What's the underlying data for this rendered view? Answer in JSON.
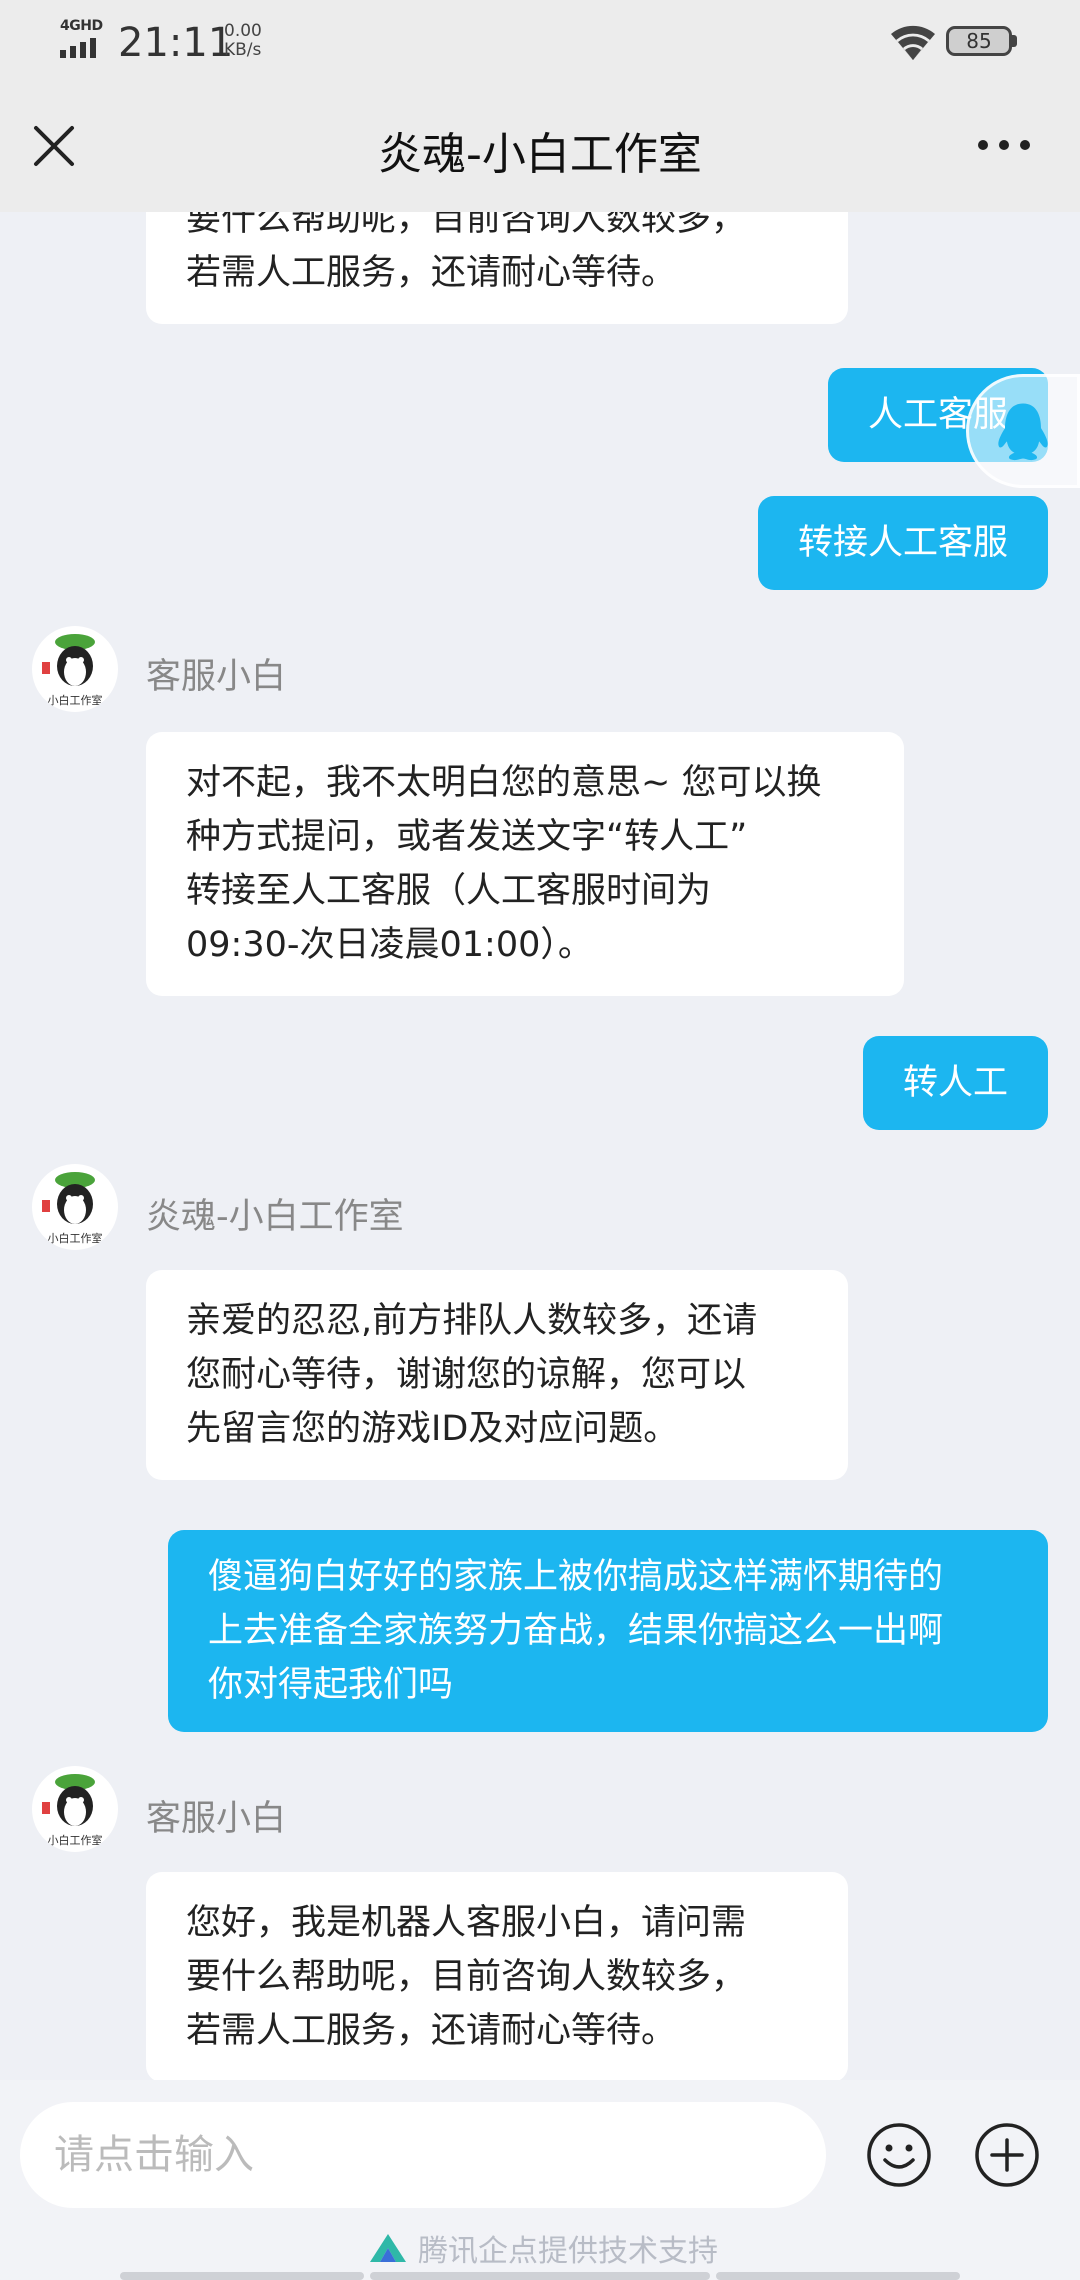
{
  "status_bar": {
    "network_label": "4GHD",
    "time": "21:11",
    "speed_value": "0.00",
    "speed_unit": "KB/s",
    "battery": "85"
  },
  "header": {
    "title": "炎魂-小白工作室"
  },
  "messages": [
    {
      "side": "left",
      "text_lines": [
        "要什么帮助呢，目前咨询人数较多，",
        "若需人工服务，还请耐心等待。"
      ]
    },
    {
      "side": "right",
      "text": "人工客服"
    },
    {
      "side": "right",
      "text": "转接人工客服"
    },
    {
      "side": "left",
      "sender": "客服小白",
      "text_lines": [
        "对不起，我不太明白您的意思~ 您可以换",
        "种方式提问，或者发送文字“转人工”",
        "转接至人工客服（人工客服时间为",
        "09:30-次日凌晨01:00）。"
      ]
    },
    {
      "side": "right",
      "text": "转人工"
    },
    {
      "side": "left",
      "sender": "炎魂-小白工作室",
      "text_lines": [
        "亲爱的忍忍,前方排队人数较多，还请",
        "您耐心等待，谢谢您的谅解，您可以",
        "先留言您的游戏ID及对应问题。"
      ]
    },
    {
      "side": "right",
      "text_lines": [
        "傻逼狗白好好的家族上被你搞成这样满怀期待的",
        "上去准备全家族努力奋战，结果你搞这么一出啊",
        "你对得起我们吗"
      ]
    },
    {
      "side": "left",
      "sender": "客服小白",
      "text_lines": [
        "您好，我是机器人客服小白，请问需",
        "要什么帮助呢，目前咨询人数较多，",
        "若需人工服务，还请耐心等待。"
      ]
    }
  ],
  "avatar_caption": "小白工作室",
  "input": {
    "placeholder": "请点击输入"
  },
  "footer": {
    "powered_by": "腾讯企点提供技术支持"
  },
  "colors": {
    "accent": "#1cb6f0",
    "background": "#eef0f5",
    "header_bg": "#ececec"
  }
}
